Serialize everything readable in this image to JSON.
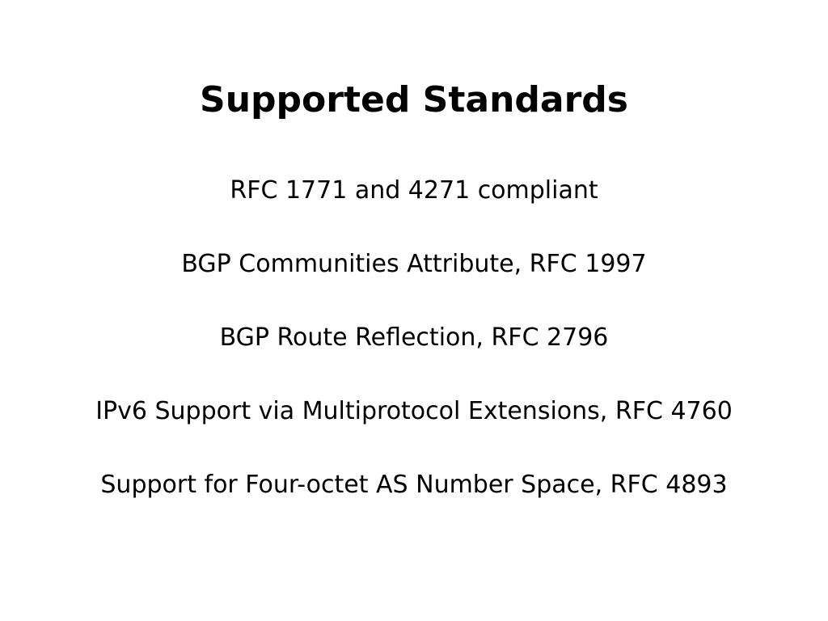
{
  "slide": {
    "title": "Supported Standards",
    "items": [
      "RFC 1771 and 4271 compliant",
      "BGP Communities Attribute, RFC 1997",
      "BGP Route Reflection, RFC 2796",
      "IPv6 Support via Multiprotocol Extensions, RFC 4760",
      "Support for Four-octet AS Number Space, RFC 4893"
    ]
  }
}
